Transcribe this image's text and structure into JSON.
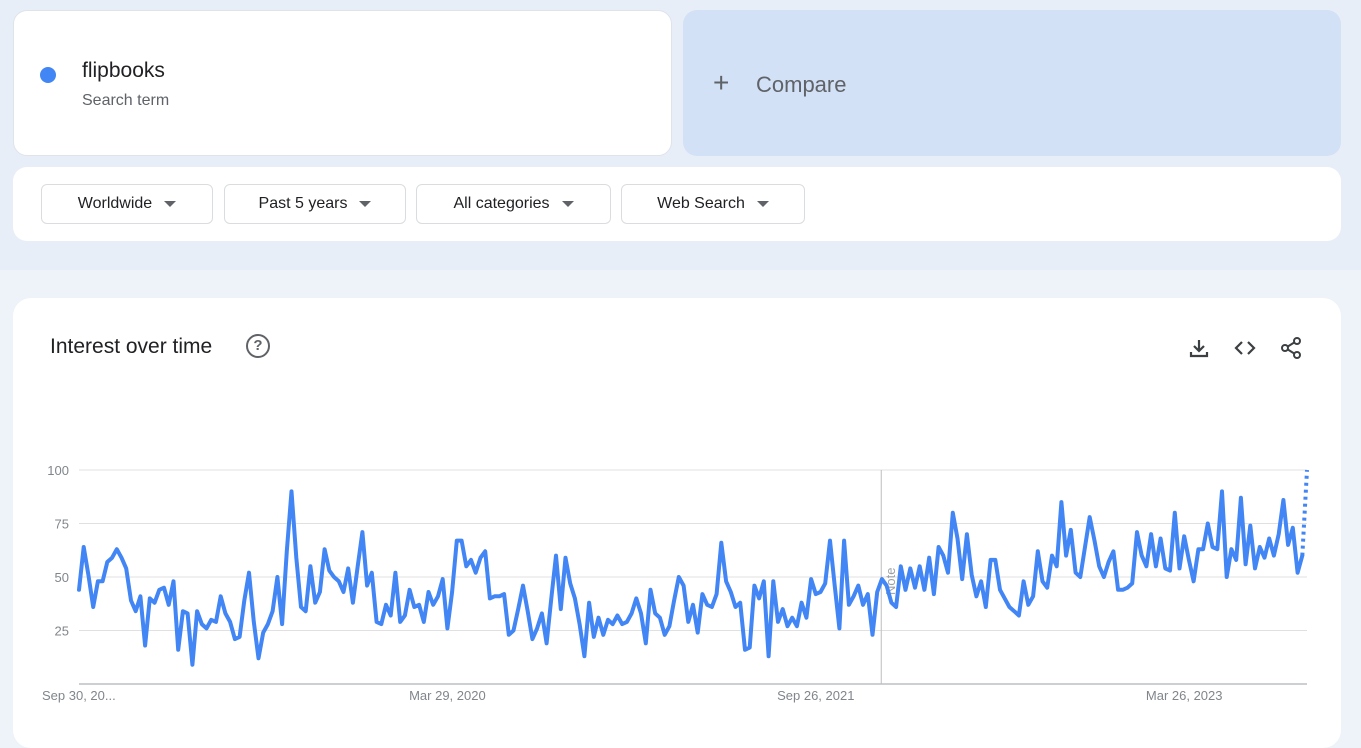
{
  "search_term": {
    "name": "flipbooks",
    "subtitle": "Search term",
    "color": "#4285f4"
  },
  "compare": {
    "plus": "+",
    "label": "Compare"
  },
  "filters": [
    {
      "label": "Worldwide"
    },
    {
      "label": "Past 5 years"
    },
    {
      "label": "All categories"
    },
    {
      "label": "Web Search"
    }
  ],
  "chart_section": {
    "title": "Interest over time",
    "help_icon": "help-circle-icon",
    "actions": [
      "download-icon",
      "embed-code-icon",
      "share-icon"
    ]
  },
  "chart_data": {
    "type": "line",
    "title": "Interest over time",
    "line_color": "#4285f4",
    "ylim": [
      0,
      100
    ],
    "yticks": [
      25,
      50,
      75,
      100
    ],
    "x_tick_labels": [
      "Sep 30, 20...",
      "Mar 29, 2020",
      "Sep 26, 2021",
      "Mar 26, 2023"
    ],
    "x_range": [
      "2018-09-30",
      "2023-09-24"
    ],
    "note_marker": {
      "date": "2022-01-01",
      "label": "Note"
    },
    "partial_last_point": true,
    "grid": true,
    "series": [
      {
        "values": [
          44,
          64,
          51,
          36,
          48,
          48,
          57,
          59,
          63,
          59,
          54,
          39,
          34,
          41,
          18,
          40,
          38,
          44,
          45,
          37,
          48,
          16,
          34,
          33,
          9,
          34,
          28,
          26,
          30,
          29,
          41,
          33,
          29,
          21,
          22,
          39,
          52,
          29,
          12,
          24,
          28,
          34,
          50,
          28,
          62,
          90,
          59,
          36,
          34,
          55,
          38,
          43,
          63,
          53,
          50,
          48,
          43,
          54,
          38,
          55,
          71,
          46,
          52,
          29,
          28,
          37,
          32,
          52,
          29,
          32,
          44,
          36,
          37,
          29,
          43,
          37,
          41,
          49,
          26,
          43,
          67,
          67,
          55,
          58,
          52,
          59,
          62,
          40,
          41,
          41,
          42,
          23,
          25,
          35,
          46,
          34,
          21,
          26,
          33,
          19,
          40,
          60,
          35,
          59,
          47,
          40,
          28,
          13,
          38,
          22,
          31,
          23,
          30,
          28,
          32,
          28,
          29,
          33,
          40,
          33,
          19,
          44,
          33,
          31,
          23,
          27,
          39,
          50,
          46,
          29,
          37,
          24,
          42,
          37,
          36,
          42,
          66,
          48,
          43,
          36,
          38,
          16,
          17,
          46,
          40,
          48,
          13,
          48,
          29,
          35,
          27,
          31,
          27,
          38,
          31,
          49,
          42,
          43,
          47,
          67,
          46,
          26,
          67,
          37,
          41,
          46,
          37,
          42,
          23,
          43,
          49,
          46,
          38,
          36,
          55,
          44,
          54,
          45,
          55,
          44,
          59,
          42,
          64,
          60,
          52,
          80,
          68,
          49,
          70,
          51,
          41,
          48,
          36,
          58,
          58,
          44,
          40,
          36,
          34,
          32,
          48,
          37,
          41,
          62,
          48,
          45,
          60,
          55,
          85,
          60,
          72,
          52,
          50,
          64,
          78,
          67,
          55,
          50,
          57,
          62,
          44,
          44,
          45,
          47,
          71,
          60,
          55,
          70,
          55,
          68,
          54,
          53,
          80,
          54,
          69,
          58,
          48,
          63,
          63,
          75,
          64,
          63,
          90,
          50,
          63,
          58,
          87,
          56,
          74,
          54,
          64,
          59,
          68,
          60,
          70,
          86,
          65,
          73,
          52,
          60
        ],
        "partial_value": 100
      }
    ]
  }
}
